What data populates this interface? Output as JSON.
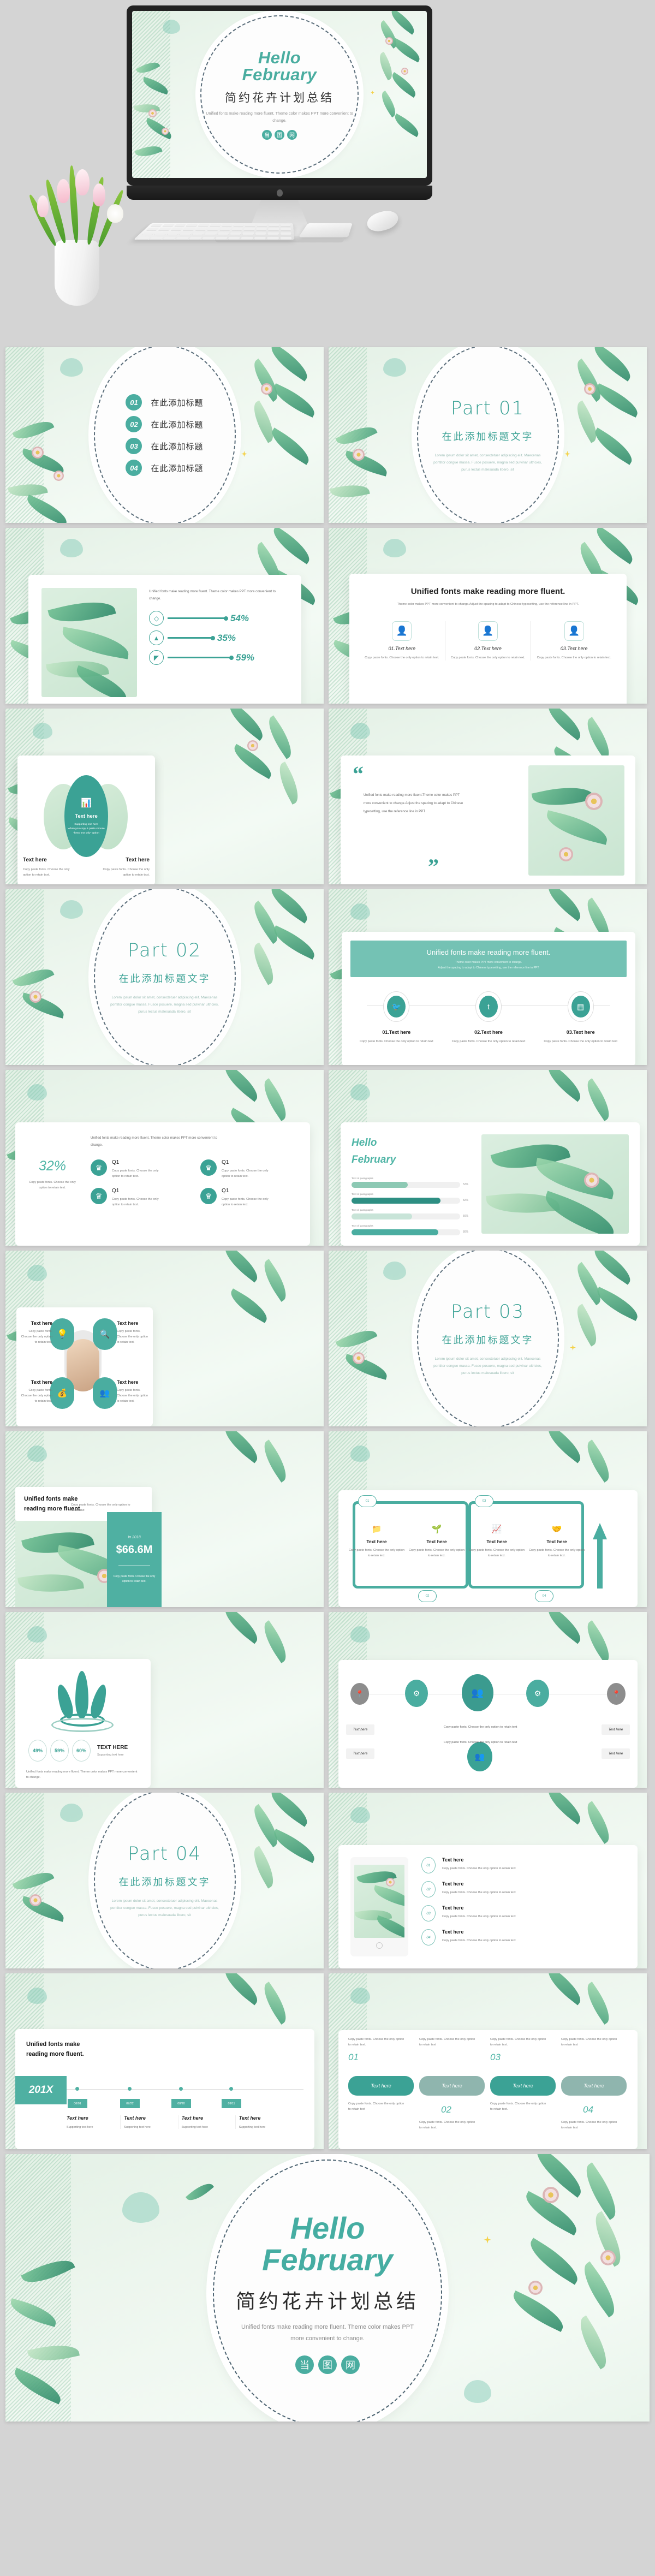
{
  "hero": {
    "title_line1": "Hello",
    "title_line2": "February",
    "title_cn": "简约花卉计划总结",
    "subtitle": "Unified fonts make reading more fluent. Theme color makes PPT more convenient to change.",
    "logo": [
      "当",
      "图",
      "网"
    ]
  },
  "common": {
    "lorem": "Lorem ipsum dolor sit amet, consectetuer adipiscing elit. Maecenas porttitor congue massa. Fusce posuere, magna sed pulvinar ultricies, purus lectus malesuada libero, sit",
    "copy_paste": "Copy paste fonts. Choose the only option to retain text.",
    "unified_short": "Unified fonts make reading more fluent.",
    "unified_two_line": "Unified fonts make reading more fluent. Theme color makes PPT more convenient to change.",
    "theme_long": "Theme color makes PPT more convenient to change.Adjust the spacing to adapt to Chinese typesetting, use the reference line in PPT.",
    "theme_l1": "Theme color makes PPT more convenient to change.",
    "theme_l2": "Adjust the spacing to adapt to Chinese typesetting, use the reference line in PPT",
    "text_here": "Text here",
    "supporting": "Supporting text here"
  },
  "slide_toc": {
    "items": [
      {
        "num": "01",
        "label": "在此添加标题"
      },
      {
        "num": "02",
        "label": "在此添加标题"
      },
      {
        "num": "03",
        "label": "在此添加标题"
      },
      {
        "num": "04",
        "label": "在此添加标题"
      }
    ]
  },
  "parts": [
    {
      "title": "Part 01",
      "cn": "在此添加标题文字"
    },
    {
      "title": "Part 02",
      "cn": "在此添加标题文字"
    },
    {
      "title": "Part 03",
      "cn": "在此添加标题文字"
    },
    {
      "title": "Part 04",
      "cn": "在此添加标题文字"
    }
  ],
  "slide_percent": {
    "intro": "Unified fonts make reading more fluent. Theme color makes PPT more convenient to change.",
    "rows": [
      {
        "icon": "layers-icon",
        "value": "54%",
        "pct": 54
      },
      {
        "icon": "bag-icon",
        "value": "35%",
        "pct": 35
      },
      {
        "icon": "ruler-icon",
        "value": "59%",
        "pct": 59
      }
    ]
  },
  "slide_three_cards": {
    "heading": "Unified fonts make reading more fluent.",
    "sub": "Theme color makes PPT more convenient to change.Adjust the spacing to adapt to Chinese typesetting, use the reference line in PPT.",
    "cards": [
      {
        "title": "01.Text here",
        "desc": "Copy paste fonts. Choose the only option to retain text."
      },
      {
        "title": "02.Text here",
        "desc": "Copy paste fonts. Choose the only option to retain text."
      },
      {
        "title": "03.Text here",
        "desc": "Copy paste fonts. Choose the only option to retain text."
      }
    ]
  },
  "slide_petal": {
    "center_title": "Text here",
    "center_sub_1": "Supporting text here",
    "center_sub_2": "When you copy & paste choose",
    "center_sub_3": "\"keep text only\" option",
    "left_title": "Text here",
    "left_desc": "Copy paste fonts. Choose the only option to retain text.",
    "right_title": "Text here",
    "right_desc": "Copy paste fonts. Choose the only option to retain text."
  },
  "slide_quote": {
    "text": "Unified fonts make reading more fluent.Theme color makes PPT more convenient to change.Adjust the spacing to adapt to Chinese typesetting, use the reference line in PPT",
    "open_quote": "“",
    "close_quote": "”"
  },
  "slide_social": {
    "banner_title": "Unified fonts make reading more fluent.",
    "banner_l1": "Theme color makes PPT more convenient to change.",
    "banner_l2": "Adjust the spacing to adapt to Chinese typesetting, use the reference line in PPT",
    "items": [
      {
        "icon": "twitter-icon",
        "title": "01.Text here",
        "desc": "Copy paste fonts. Choose the only option to retain text"
      },
      {
        "icon": "tumblr-icon",
        "title": "02.Text here",
        "desc": "Copy paste fonts. Choose the only option to retain text"
      },
      {
        "icon": "windows-icon",
        "title": "03.Text here",
        "desc": "Copy paste fonts. Choose the only option to retain text"
      }
    ]
  },
  "slide_32": {
    "big_value": "32%",
    "big_desc": "Copy paste fonts. Choose the only option to retain text.",
    "intro": "Unified fonts make reading more fluent. Theme color makes PPT more convenient to change.",
    "quadrants": [
      {
        "label": "Q1",
        "desc": "Copy paste fonts. Choose the only option to retain text."
      },
      {
        "label": "Q1",
        "desc": "Copy paste fonts. Choose the only option to retain text."
      },
      {
        "label": "Q1",
        "desc": "Copy paste fonts. Choose the only option to retain text."
      },
      {
        "label": "Q1",
        "desc": "Copy paste fonts. Choose the only option to retain text."
      }
    ]
  },
  "slide_hellobars": {
    "title_1": "Hello",
    "title_2": "February",
    "bars": [
      {
        "label": "Text of paragraphs",
        "value": "52%",
        "pct": 52,
        "color": "#8dc9b4"
      },
      {
        "label": "Text of paragraphs",
        "value": "82%",
        "pct": 82,
        "color": "#2e8f83"
      },
      {
        "label": "Text of paragraphs",
        "value": "56%",
        "pct": 56,
        "color": "#c8e4d8"
      },
      {
        "label": "Text of paragraphs",
        "value": "80%",
        "pct": 80,
        "color": "#4aada0"
      }
    ]
  },
  "slide_portrait": {
    "items": [
      {
        "icon": "bulb-icon",
        "title": "Text here",
        "desc": "Copy paste fonts. Choose the only option to retain text."
      },
      {
        "icon": "search-icon",
        "title": "Text here",
        "desc": "Copy paste fonts. Choose the only option to retain text."
      },
      {
        "icon": "money-bag-icon",
        "title": "Text here",
        "desc": "Copy paste fonts. Choose the only option to retain text."
      },
      {
        "icon": "people-icon",
        "title": "Text here",
        "desc": "Copy paste fonts. Choose the only option to retain text."
      }
    ]
  },
  "slide_money": {
    "heading_l1": "Unified fonts make",
    "heading_l2": "reading more fluent.",
    "desc": "Copy paste fonts. Choose the only option to retain text",
    "year_label": "In 2018",
    "amount": "$66.6M",
    "amount_desc": "Copy paste fonts. Choose the only option to retain text."
  },
  "slide_snake": {
    "steps": [
      {
        "num": "01",
        "icon": "folder-icon",
        "title": "Text here",
        "desc": "Copy paste fonts. Choose the only option to retain text."
      },
      {
        "num": "02",
        "icon": "plant-hand-icon",
        "title": "Text here",
        "desc": "Copy paste fonts. Choose the only option to retain text."
      },
      {
        "num": "03",
        "icon": "chart-icon",
        "title": "Text here",
        "desc": "Copy paste fonts. Choose the only option to retain text."
      },
      {
        "num": "04",
        "icon": "handshake-icon",
        "title": "Text here",
        "desc": "Copy paste fonts. Choose the only option to retain text."
      }
    ]
  },
  "slide_leaflogo": {
    "stats": [
      "49%",
      "59%",
      "60%"
    ],
    "title": "TEXT HERE",
    "sub": "Supporting text here",
    "footer": "Unified fonts make reading more fluent. Theme color makes PPT more convenient to change."
  },
  "slide_network": {
    "nodes": [
      "pin-icon",
      "gear-icon",
      "people-icon",
      "gear-icon",
      "pin-icon"
    ],
    "labels": [
      "Text here",
      "Text here",
      "Text here",
      "Text here"
    ],
    "center_desc_1": "Copy paste fonts. Choose the only option to retain text",
    "center_desc_2": "Copy paste fonts. Choose the only option to retain text"
  },
  "slide_tablet": {
    "items": [
      {
        "num": "01",
        "title": "Text here",
        "desc": "Copy paste fonts. Choose the only option to retain text"
      },
      {
        "num": "02",
        "title": "Text here",
        "desc": "Copy paste fonts. Choose the only option to retain text"
      },
      {
        "num": "03",
        "title": "Text here",
        "desc": "Copy paste fonts. Choose the only option to retain text"
      },
      {
        "num": "04",
        "title": "Text here",
        "desc": "Copy paste fonts. Choose the only option to retain text"
      }
    ]
  },
  "slide_timeline": {
    "heading_l1": "Unified fonts make",
    "heading_l2": "reading more fluent.",
    "year": "201X",
    "points": [
      {
        "date": "06/01",
        "title": "Text here",
        "sub": "Supporting text here"
      },
      {
        "date": "07/22",
        "title": "Text here",
        "sub": "Supporting text here"
      },
      {
        "date": "08/20",
        "title": "Text here",
        "sub": "Supporting text here"
      },
      {
        "date": "09/11",
        "title": "Text here",
        "sub": "Supporting text here"
      }
    ]
  },
  "slide_bubbles": {
    "groups": [
      {
        "num": "01",
        "label": "Text here",
        "color": "#3ba295",
        "above": "Copy paste fonts. Choose the only option to retain text.",
        "below": "Copy paste fonts. Choose the only option to retain text"
      },
      {
        "num": "02",
        "label": "Text here",
        "color": "#8fb5ae",
        "above": "Copy paste fonts. Choose the only option to retain text",
        "below": "Copy paste fonts. Choose the only option to retain text."
      },
      {
        "num": "03",
        "label": "Text here",
        "color": "#3ba295",
        "above": "Copy paste fonts. Choose the only option to retain text.",
        "below": "Copy paste fonts. Choose the only option to retain text."
      },
      {
        "num": "04",
        "label": "Text here",
        "color": "#8fb5ae",
        "above": "Copy paste fonts. Choose the only option to retain text",
        "below": "Copy paste fonts. Choose the only option to retain text"
      }
    ]
  },
  "final": {
    "title_1": "Hello",
    "title_2": "February",
    "title_cn": "简约花卉计划总结",
    "subtitle": "Unified fonts make reading more fluent. Theme color makes PPT more convenient to change.",
    "logo": [
      "当",
      "图",
      "网"
    ]
  },
  "colors": {
    "accent": "#3ba295",
    "accent_light": "#4aada0",
    "accent_muted": "#8fb5ae",
    "bg_page": "#d4d4d4",
    "slide_bg": "#eef6ef",
    "text_dark": "#2d2d2d",
    "text_muted": "#8d8d8d"
  }
}
